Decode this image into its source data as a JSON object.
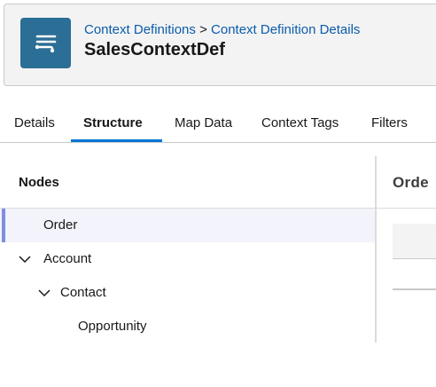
{
  "header": {
    "icon": "context-definition-icon",
    "breadcrumb": {
      "parent": "Context Definitions",
      "separator": ">",
      "current": "Context Definition Details"
    },
    "title": "SalesContextDef"
  },
  "tabs": [
    {
      "label": "Details",
      "active": false
    },
    {
      "label": "Structure",
      "active": true
    },
    {
      "label": "Map Data",
      "active": false
    },
    {
      "label": "Context Tags",
      "active": false
    },
    {
      "label": "Filters",
      "active": false
    }
  ],
  "nodes": {
    "heading": "Nodes",
    "items": [
      {
        "label": "Order",
        "selected": true,
        "expanded": false
      },
      {
        "label": "Account",
        "expanded": true
      },
      {
        "label": "Contact",
        "expanded": true
      },
      {
        "label": "Opportunity",
        "expanded": false
      }
    ]
  },
  "detail": {
    "title": "Orde"
  },
  "colors": {
    "brand": "#2b6e96",
    "link": "#0b5cab",
    "active_tab": "#0176d3",
    "selected_row": "#f3f3fb",
    "selected_marker": "#7f8de1"
  }
}
